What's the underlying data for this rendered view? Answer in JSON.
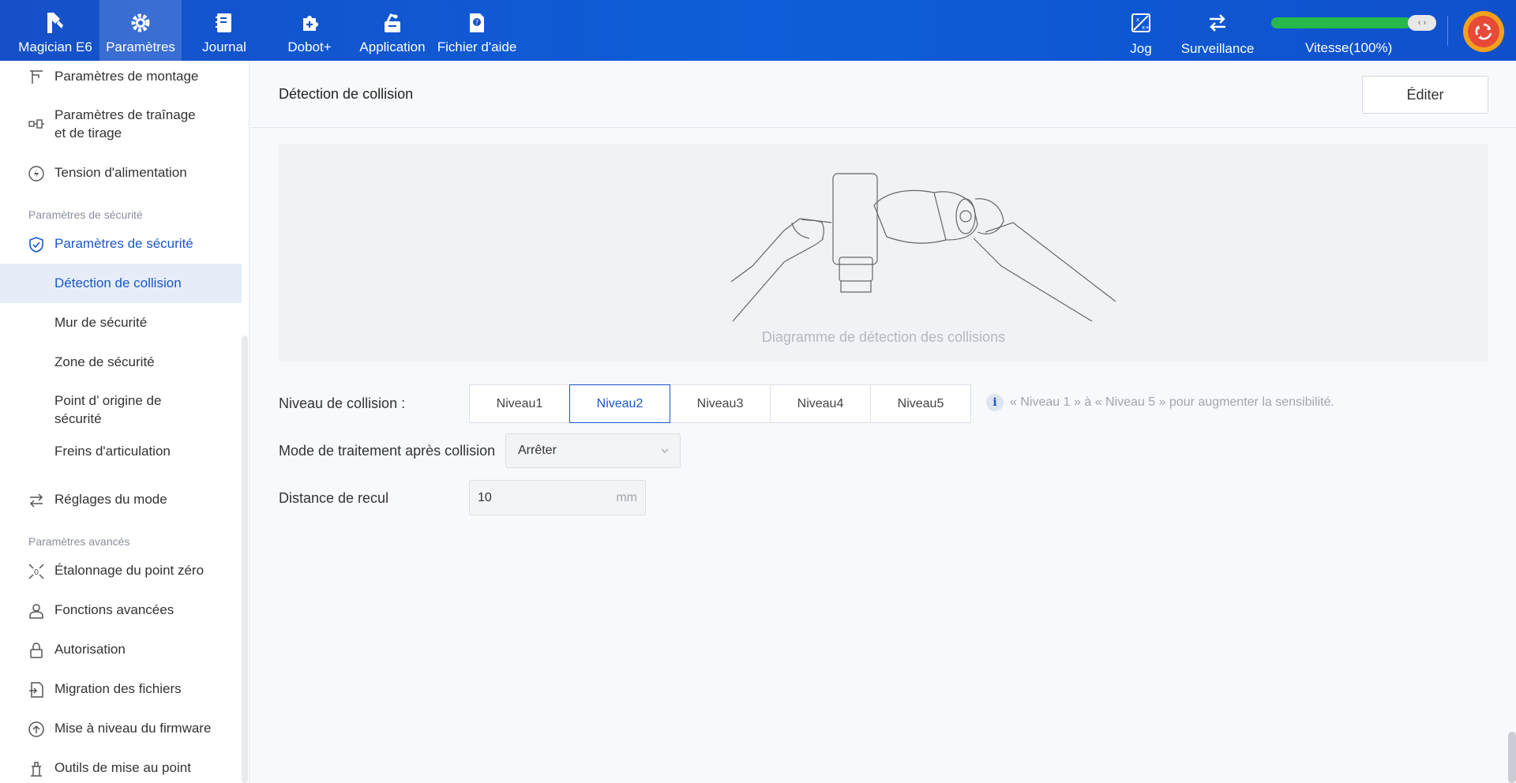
{
  "topnav": {
    "items": [
      {
        "label": "Magician E6"
      },
      {
        "label": "Paramètres"
      },
      {
        "label": "Journal"
      },
      {
        "label": "Dobot+"
      },
      {
        "label": "Application"
      },
      {
        "label": "Fichier d'aide"
      }
    ],
    "active_index": 1,
    "right": {
      "jog": "Jog",
      "monitor": "Surveillance",
      "speed_label": "Vitesse(100%)",
      "speed_percent": 100,
      "slider_thumb": "‹ ›"
    }
  },
  "sidebar": {
    "items_top": [
      {
        "label": "Paramètres de montage",
        "icon": "mount-icon"
      },
      {
        "label": "Paramètres de traînage et de tirage",
        "icon": "drag-icon"
      },
      {
        "label": "Tension d'alimentation",
        "icon": "power-icon"
      }
    ],
    "group_security": "Paramètres de sécurité",
    "security_parent": "Paramètres de sécurité",
    "security_children": [
      {
        "label": "Détection de collision"
      },
      {
        "label": "Mur de sécurité"
      },
      {
        "label": "Zone de sécurité"
      },
      {
        "label": "Point d’ origine de sécurité"
      },
      {
        "label": "Freins d'articulation"
      }
    ],
    "active_child": 0,
    "mode_settings": "Réglages du mode",
    "group_advanced": "Paramètres avancés",
    "items_advanced": [
      {
        "label": "Étalonnage du point zéro",
        "icon": "zero-calibration-icon"
      },
      {
        "label": "Fonctions avancées",
        "icon": "user-icon"
      },
      {
        "label": "Autorisation",
        "icon": "lock-icon"
      },
      {
        "label": "Migration des fichiers",
        "icon": "file-migration-icon"
      },
      {
        "label": "Mise à niveau du firmware",
        "icon": "upgrade-icon"
      },
      {
        "label": "Outils de mise au point",
        "icon": "debug-tools-icon"
      }
    ]
  },
  "main": {
    "title": "Détection de collision",
    "edit_label": "Éditer",
    "diagram_caption": "Diagramme de détection des collisions",
    "collision_level_label": "Niveau de collision :",
    "levels": [
      "Niveau1",
      "Niveau2",
      "Niveau3",
      "Niveau4",
      "Niveau5"
    ],
    "selected_level": 1,
    "hint": "« Niveau 1 » à « Niveau 5 » pour augmenter la sensibilité.",
    "mode_label": "Mode de traitement après collision",
    "mode_value": "Arrêter",
    "distance_label": "Distance de recul",
    "distance_value": "10",
    "distance_unit": "mm"
  }
}
